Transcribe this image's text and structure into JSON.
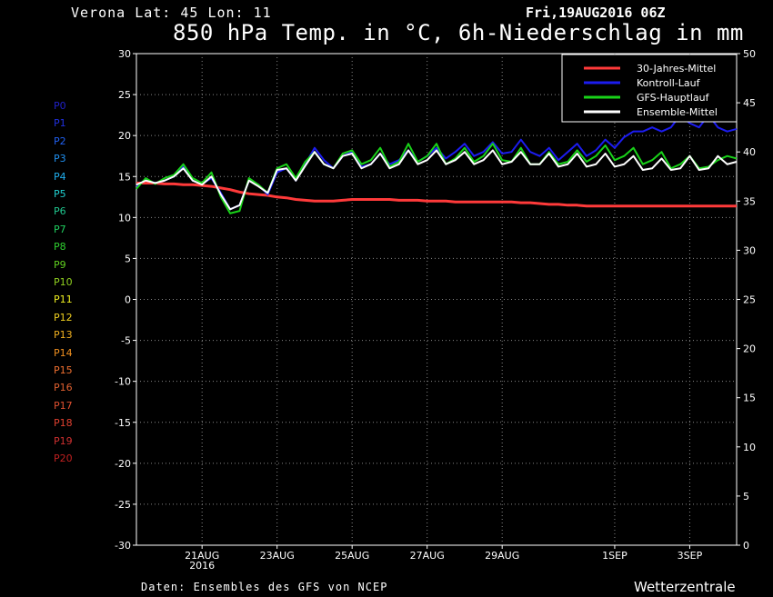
{
  "header": {
    "location": "Verona   Lat: 45 Lon: 11",
    "run": "Fri,19AUG2016 06Z",
    "title": "850 hPa Temp. in °C, 6h-Niederschlag in mm"
  },
  "footer": {
    "source": "Daten: Ensembles des GFS von NCEP",
    "brand": "Wetterzentrale"
  },
  "members": [
    {
      "label": "P0",
      "color": "#2020c8"
    },
    {
      "label": "P1",
      "color": "#2030e0"
    },
    {
      "label": "P2",
      "color": "#2060f0"
    },
    {
      "label": "P3",
      "color": "#2090f0"
    },
    {
      "label": "P4",
      "color": "#20b0f0"
    },
    {
      "label": "P5",
      "color": "#20d0d0"
    },
    {
      "label": "P6",
      "color": "#20c890"
    },
    {
      "label": "P7",
      "color": "#20d060"
    },
    {
      "label": "P8",
      "color": "#30d030"
    },
    {
      "label": "P9",
      "color": "#60d020"
    },
    {
      "label": "P10",
      "color": "#90d020"
    },
    {
      "label": "P11",
      "color": "#f0f020"
    },
    {
      "label": "P12",
      "color": "#f0d020"
    },
    {
      "label": "P13",
      "color": "#f0b020"
    },
    {
      "label": "P14",
      "color": "#f09020"
    },
    {
      "label": "P15",
      "color": "#f07030"
    },
    {
      "label": "P16",
      "color": "#e06030"
    },
    {
      "label": "P17",
      "color": "#e05030"
    },
    {
      "label": "P18",
      "color": "#e04030"
    },
    {
      "label": "P19",
      "color": "#d03030"
    },
    {
      "label": "P20",
      "color": "#c02020"
    }
  ],
  "chart_data": {
    "type": "line",
    "x_unit": "6-hourly steps from 19AUG2016 06Z",
    "x_ticks": [
      {
        "step": 7,
        "label": "21AUG",
        "sublabel": "2016"
      },
      {
        "step": 15,
        "label": "23AUG",
        "sublabel": ""
      },
      {
        "step": 23,
        "label": "25AUG",
        "sublabel": ""
      },
      {
        "step": 31,
        "label": "27AUG",
        "sublabel": ""
      },
      {
        "step": 39,
        "label": "29AUG",
        "sublabel": ""
      },
      {
        "step": 51,
        "label": "1SEP",
        "sublabel": ""
      },
      {
        "step": 59,
        "label": "3SEP",
        "sublabel": ""
      }
    ],
    "xlim": [
      0,
      64
    ],
    "y_left": {
      "label": "850 hPa Temp. °C",
      "ylim": [
        -30,
        30
      ],
      "ticks": [
        30,
        25,
        20,
        15,
        10,
        5,
        0,
        -5,
        -10,
        -15,
        -20,
        -25,
        -30
      ]
    },
    "y_right": {
      "label": "6h-Niederschlag mm",
      "ylim": [
        0,
        50
      ],
      "ticks": [
        50,
        45,
        40,
        35,
        30,
        25,
        20,
        15,
        10,
        5,
        0
      ]
    },
    "grid": true,
    "legend_position": "top-right",
    "legend": [
      {
        "name": "30-Jahres-Mittel",
        "color": "#ff3a3a"
      },
      {
        "name": "Kontroll-Lauf",
        "color": "#1c1cf0"
      },
      {
        "name": "GFS-Hauptlauf",
        "color": "#19d219"
      },
      {
        "name": "Ensemble-Mittel",
        "color": "#ffffff"
      }
    ],
    "series": [
      {
        "name": "30-Jahres-Mittel",
        "color": "#ff3a3a",
        "axis": "left",
        "values": [
          14.2,
          14.2,
          14.2,
          14.1,
          14.1,
          14.0,
          14.0,
          13.9,
          13.8,
          13.6,
          13.4,
          13.1,
          12.9,
          12.8,
          12.7,
          12.5,
          12.4,
          12.2,
          12.1,
          12.0,
          12.0,
          12.0,
          12.1,
          12.2,
          12.2,
          12.2,
          12.2,
          12.2,
          12.1,
          12.1,
          12.1,
          12.0,
          12.0,
          12.0,
          11.9,
          11.9,
          11.9,
          11.9,
          11.9,
          11.9,
          11.9,
          11.8,
          11.8,
          11.7,
          11.6,
          11.6,
          11.5,
          11.5,
          11.4,
          11.4,
          11.4,
          11.4,
          11.4,
          11.4,
          11.4,
          11.4,
          11.4,
          11.4,
          11.4,
          11.4,
          11.4,
          11.4,
          11.4,
          11.4,
          11.4
        ]
      },
      {
        "name": "Kontroll-Lauf",
        "color": "#1c1cf0",
        "axis": "left",
        "values": [
          13.8,
          14.6,
          14.2,
          14.5,
          15.0,
          16.2,
          14.5,
          14.1,
          14.8,
          13.0,
          11.0,
          11.5,
          14.5,
          14.0,
          12.8,
          15.5,
          16.0,
          14.5,
          16.5,
          18.5,
          17.0,
          16.0,
          17.5,
          18.0,
          16.2,
          16.5,
          17.8,
          16.5,
          17.0,
          18.2,
          16.8,
          17.5,
          18.5,
          17.2,
          18.0,
          19.0,
          17.5,
          18.0,
          19.2,
          17.8,
          18.0,
          19.5,
          18.0,
          17.5,
          18.5,
          17.0,
          18.0,
          19.0,
          17.5,
          18.2,
          19.5,
          18.5,
          19.8,
          20.5,
          20.5,
          21.0,
          20.5,
          21.0,
          22.5,
          21.5,
          21.0,
          22.5,
          21.0,
          20.5,
          20.8
        ]
      },
      {
        "name": "GFS-Hauptlauf",
        "color": "#19d219",
        "axis": "left",
        "values": [
          13.5,
          14.8,
          14.1,
          14.8,
          15.2,
          16.5,
          14.8,
          14.2,
          15.5,
          12.5,
          10.5,
          10.8,
          14.8,
          14.0,
          13.0,
          16.0,
          16.5,
          14.8,
          16.8,
          18.0,
          16.5,
          16.0,
          17.8,
          18.2,
          16.5,
          17.0,
          18.5,
          16.2,
          16.8,
          19.0,
          16.8,
          17.5,
          19.0,
          16.5,
          17.2,
          18.5,
          16.8,
          17.5,
          19.0,
          17.0,
          16.8,
          18.5,
          16.5,
          16.5,
          18.0,
          16.5,
          16.8,
          18.2,
          16.8,
          17.5,
          18.8,
          17.0,
          17.5,
          18.5,
          16.5,
          17.0,
          18.0,
          16.0,
          16.5,
          17.5,
          16.0,
          16.2,
          17.0,
          17.5,
          17.2
        ]
      },
      {
        "name": "Ensemble-Mittel",
        "color": "#ffffff",
        "axis": "left",
        "values": [
          14.0,
          14.5,
          14.2,
          14.5,
          15.0,
          16.0,
          14.5,
          14.0,
          15.0,
          12.8,
          11.0,
          11.5,
          14.5,
          13.8,
          13.0,
          15.8,
          16.0,
          14.5,
          16.3,
          18.0,
          16.5,
          16.0,
          17.5,
          17.8,
          16.0,
          16.5,
          17.8,
          16.0,
          16.5,
          18.2,
          16.5,
          17.0,
          18.2,
          16.5,
          17.0,
          18.0,
          16.5,
          17.0,
          18.2,
          16.5,
          16.8,
          18.0,
          16.5,
          16.5,
          17.8,
          16.2,
          16.5,
          17.8,
          16.2,
          16.5,
          17.8,
          16.2,
          16.5,
          17.5,
          15.8,
          16.0,
          17.2,
          15.8,
          16.0,
          17.5,
          15.8,
          16.0,
          17.5,
          16.5,
          16.8
        ]
      }
    ]
  }
}
